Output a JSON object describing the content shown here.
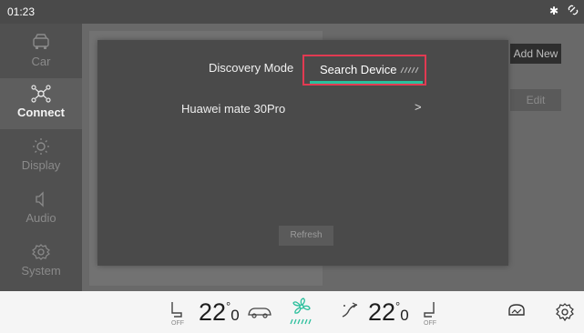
{
  "status": {
    "time": "01:23",
    "bt_icon": "bluetooth-icon",
    "link_icon": "link-icon"
  },
  "sidebar": {
    "items": [
      {
        "label": "Car",
        "icon": "car-icon"
      },
      {
        "label": "Connect",
        "icon": "connect-icon",
        "active": true
      },
      {
        "label": "Display",
        "icon": "brightness-icon"
      },
      {
        "label": "Audio",
        "icon": "speaker-icon"
      },
      {
        "label": "System",
        "icon": "gear-icon"
      }
    ]
  },
  "background": {
    "add_new": "Add New",
    "edit": "Edit"
  },
  "modal": {
    "tab_discovery": "Discovery Mode",
    "tab_search": "Search Device",
    "devices": [
      {
        "name": "Huawei mate 30Pro",
        "chevron": ">"
      }
    ],
    "refresh": "Refresh",
    "accent": "#2bbf9c",
    "highlight": "#e23a52"
  },
  "climate": {
    "left_temp": "22",
    "left_dec": "0",
    "right_temp": "22",
    "right_dec": "0",
    "deg": "°",
    "seat_left_off": "OFF",
    "seat_right_off": "OFF"
  }
}
